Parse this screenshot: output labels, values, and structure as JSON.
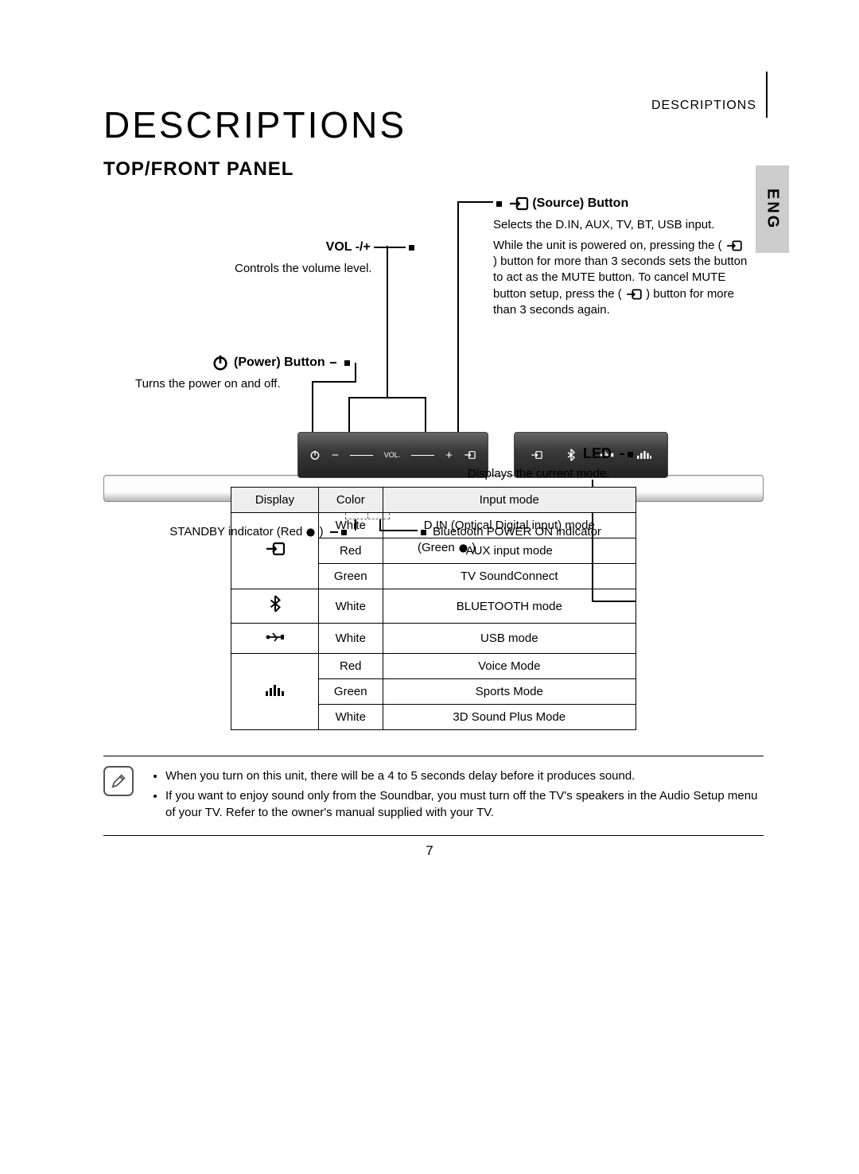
{
  "header": {
    "section": "DESCRIPTIONS",
    "lang_tab": "ENG"
  },
  "title": "DESCRIPTIONS",
  "subtitle": "TOP/FRONT PANEL",
  "callouts": {
    "vol": {
      "label": "VOL -/+",
      "desc": "Controls the volume level."
    },
    "power": {
      "label": "(Power) Button",
      "desc": "Turns the power on and off."
    },
    "source": {
      "label": "(Source) Button",
      "line1": "Selects the D.IN, AUX, TV, BT, USB input.",
      "line2a": "While the unit is powered on, pressing the (",
      "line2b": ") button for more than 3 seconds sets the button to act as the MUTE button. To cancel MUTE button setup, press the (",
      "line2c": ") button for more than 3 seconds again."
    },
    "standby": {
      "text_a": "STANDBY indicator (Red ",
      "text_b": ")"
    },
    "bt_power": {
      "text_a": "Bluetooth POWER ON indicator (Green ",
      "text_b": ")"
    }
  },
  "panel_label": "VOL.",
  "led": {
    "heading": "LED",
    "subtitle": "Displays the current mode.",
    "headers": {
      "display": "Display",
      "color": "Color",
      "mode": "Input mode"
    },
    "rows": [
      {
        "color": "White",
        "mode": "D.IN (Optical Digital input) mode"
      },
      {
        "color": "Red",
        "mode": "AUX input mode"
      },
      {
        "color": "Green",
        "mode": "TV SoundConnect"
      },
      {
        "color": "White",
        "mode": "BLUETOOTH mode"
      },
      {
        "color": "White",
        "mode": "USB mode"
      },
      {
        "color": "Red",
        "mode": "Voice Mode"
      },
      {
        "color": "Green",
        "mode": "Sports Mode"
      },
      {
        "color": "White",
        "mode": "3D Sound Plus Mode"
      }
    ]
  },
  "notes": {
    "items": [
      "When you turn on this unit, there will be a 4 to 5 seconds delay before it produces sound.",
      "If you want to enjoy sound only from the Soundbar, you must turn off the TV's speakers in the Audio Setup menu of your TV. Refer to the owner's manual supplied with your TV."
    ]
  },
  "page_number": "7"
}
